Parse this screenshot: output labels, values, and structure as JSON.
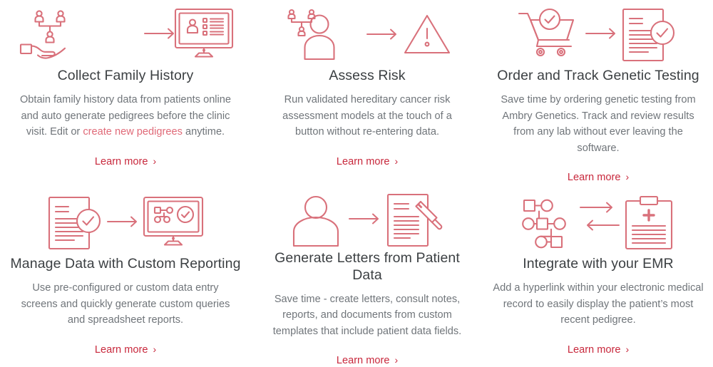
{
  "theme": {
    "page_background": "#ffffff",
    "icon_stroke": "#d9717b",
    "title_color": "#3c4043",
    "body_color": "#70757a",
    "link_color": "#c8283c",
    "inline_link_color": "#e06a78"
  },
  "cards": [
    {
      "icon_name": "hand-holding-pedigree-to-monitor-icon",
      "title": "Collect Family History",
      "desc_before_link": "Obtain family history data from patients online and auto generate pedigrees before the clinic visit. Edit or ",
      "desc_link": "create new pedigrees",
      "desc_after_link": " anytime.",
      "link_label": "Learn more",
      "link_chevron": "›"
    },
    {
      "icon_name": "person-pedigree-to-risk-warning-icon",
      "title": "Assess Risk",
      "desc": "Run validated hereditary cancer risk assessment models at the touch of a button without re-entering data.",
      "link_label": "Learn more",
      "link_chevron": "›"
    },
    {
      "icon_name": "shopping-cart-check-to-document-check-icon",
      "title": "Order and Track Genetic Testing",
      "desc": "Save time by ordering genetic testing from Ambry Genetics. Track and review results from any lab without ever leaving the software.",
      "link_label": "Learn more",
      "link_chevron": "›"
    },
    {
      "icon_name": "document-check-to-monitor-report-icon",
      "title": "Manage Data with Custom Reporting",
      "desc": "Use pre-configured or custom data entry screens and quickly generate custom queries and spreadsheet reports.",
      "link_label": "Learn more",
      "link_chevron": "›"
    },
    {
      "icon_name": "person-to-document-pencil-icon",
      "title": "Generate Letters from Patient Data",
      "desc": "Save time - create letters, consult notes, reports, and documents from custom templates that include patient data fields.",
      "link_label": "Learn more",
      "link_chevron": "›"
    },
    {
      "icon_name": "pedigree-exchange-medical-clipboard-icon",
      "title": "Integrate with your EMR",
      "desc": "Add a hyperlink within your electronic medical record to easily display the patient’s most recent pedigree.",
      "link_label": "Learn more",
      "link_chevron": "›"
    }
  ]
}
